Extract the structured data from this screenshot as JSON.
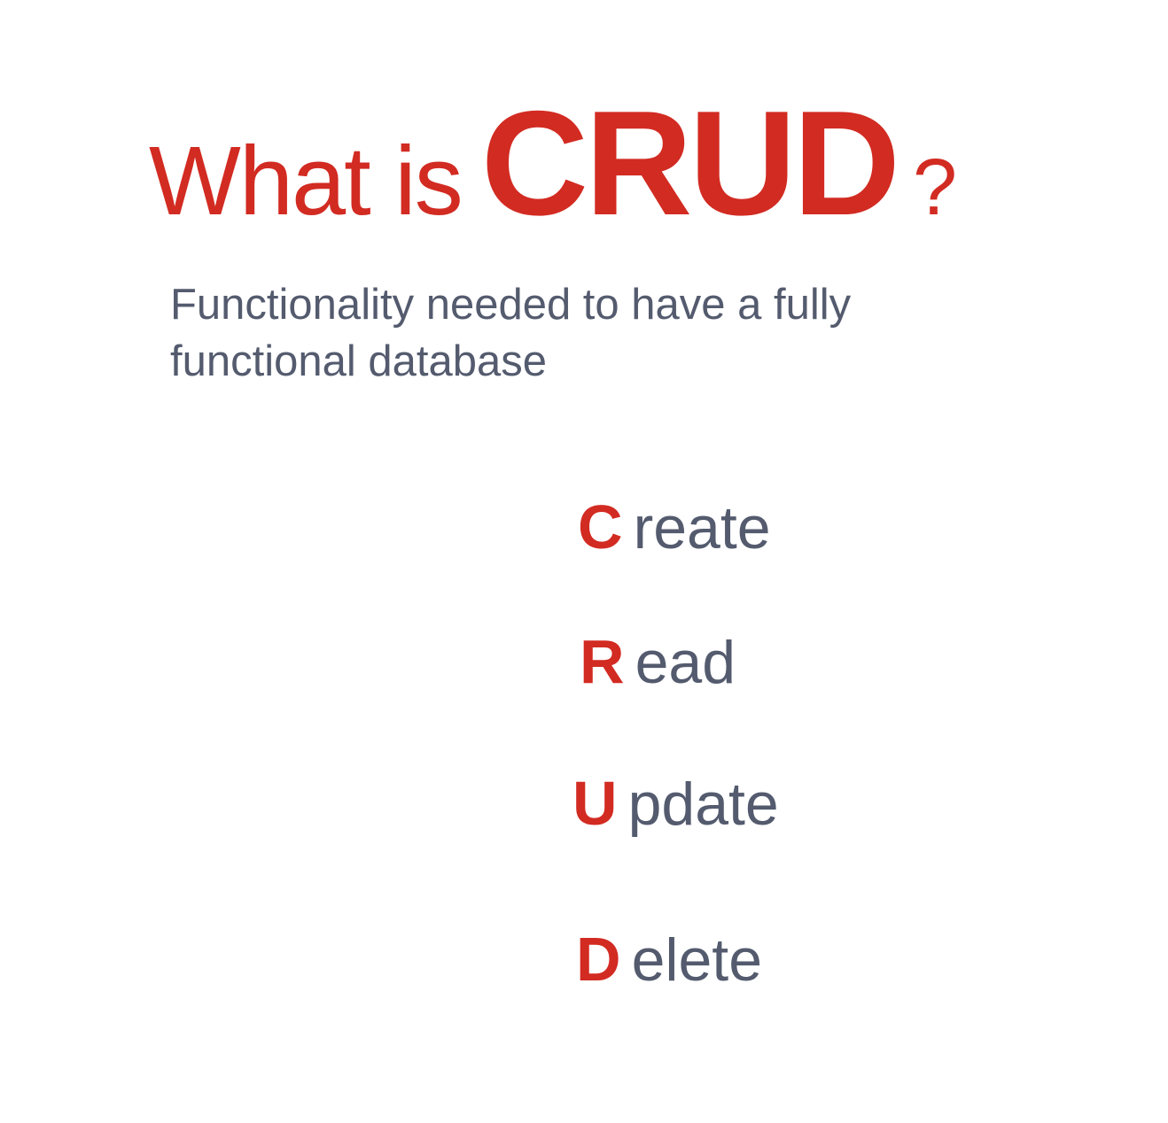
{
  "title": {
    "lead": "What is",
    "highlight": "CRUD",
    "question_mark": "?"
  },
  "subtitle": "Functionality needed to have a fully functional database",
  "crud": [
    {
      "letter": "C",
      "rest": "reate"
    },
    {
      "letter": "R",
      "rest": "ead"
    },
    {
      "letter": "U",
      "rest": "pdate"
    },
    {
      "letter": "D",
      "rest": "elete"
    }
  ],
  "colors": {
    "accent": "#d22b22",
    "text": "#545b6e",
    "background": "#ffffff"
  }
}
